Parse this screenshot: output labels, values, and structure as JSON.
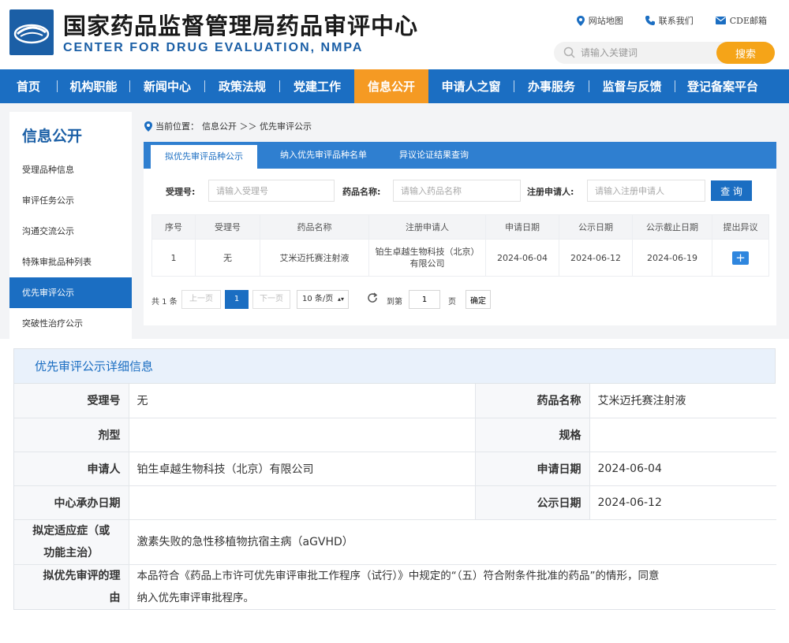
{
  "header": {
    "title": "国家药品监督管理局药品审评中心",
    "subtitle": "CENTER FOR DRUG EVALUATION, NMPA",
    "links": [
      {
        "label": "网站地图",
        "icon": "map-pin-icon"
      },
      {
        "label": "联系我们",
        "icon": "phone-icon"
      },
      {
        "label": "CDE邮箱",
        "icon": "mail-icon"
      }
    ],
    "search": {
      "placeholder": "请输入关键词",
      "button": "搜索"
    }
  },
  "nav": {
    "items": [
      "首页",
      "机构职能",
      "新闻中心",
      "政策法规",
      "党建工作",
      "信息公开",
      "申请人之窗",
      "办事服务",
      "监督与反馈",
      "登记备案平台"
    ],
    "active": "信息公开"
  },
  "sidebar": {
    "title": "信息公开",
    "items": [
      "受理品种信息",
      "审评任务公示",
      "沟通交流公示",
      "特殊审批品种列表",
      "优先审评公示",
      "突破性治疗公示"
    ],
    "active": "优先审评公示"
  },
  "breadcrumb": {
    "prefix": "当前位置：",
    "path": "信息公开 ＞＞ 优先审评公示"
  },
  "tabs": [
    "拟优先审评品种公示",
    "纳入优先审评品种名单",
    "异议论证结果查询"
  ],
  "filters": {
    "accept_label": "受理号:",
    "accept_placeholder": "请输入受理号",
    "drug_label": "药品名称:",
    "drug_placeholder": "请输入药品名称",
    "applicant_label": "注册申请人:",
    "applicant_placeholder": "请输入注册申请人",
    "query_button": "查 询"
  },
  "table": {
    "columns": [
      "序号",
      "受理号",
      "药品名称",
      "注册申请人",
      "申请日期",
      "公示日期",
      "公示截止日期",
      "提出异议"
    ],
    "rows": [
      {
        "no": "1",
        "accept_no": "无",
        "drug": "艾米迈托赛注射液",
        "applicant": "铂生卓越生物科技（北京）有限公司",
        "apply_date": "2024-06-04",
        "publish_date": "2024-06-12",
        "deadline": "2024-06-19",
        "objection": "+"
      }
    ]
  },
  "pager": {
    "total": "共 1 条",
    "prev": "上一页",
    "current": "1",
    "next": "下一页",
    "page_size": "10 条/页",
    "goto_label": "到第",
    "goto_value": "1",
    "page_unit": "页",
    "confirm": "确定"
  },
  "detail": {
    "title": "优先审评公示详细信息",
    "accept_no_label": "受理号",
    "accept_no": "无",
    "drug_label": "药品名称",
    "drug": "艾米迈托赛注射液",
    "form_label": "剂型",
    "form": "",
    "spec_label": "规格",
    "spec": "",
    "applicant_label": "申请人",
    "applicant": "铂生卓越生物科技（北京）有限公司",
    "apply_date_label": "申请日期",
    "apply_date": "2024-06-04",
    "center_date_label": "中心承办日期",
    "center_date": "",
    "publish_date_label": "公示日期",
    "publish_date": "2024-06-12",
    "indication_label_1": "拟定适应症（或",
    "indication_label_2": "功能主治）",
    "indication": "激素失败的急性移植物抗宿主病（aGVHD）",
    "reason_label_1": "拟优先审评的理",
    "reason_label_2": "由",
    "reason_1": "本品符合《药品上市许可优先审评审批工作程序（试行）》中规定的“（五）符合附条件批准的药品”的情形，同意",
    "reason_2": "纳入优先审评审批程序。"
  },
  "colors": {
    "brand_blue": "#1b6ec2",
    "accent_orange": "#f59a23",
    "search_orange": "#f5a418"
  }
}
